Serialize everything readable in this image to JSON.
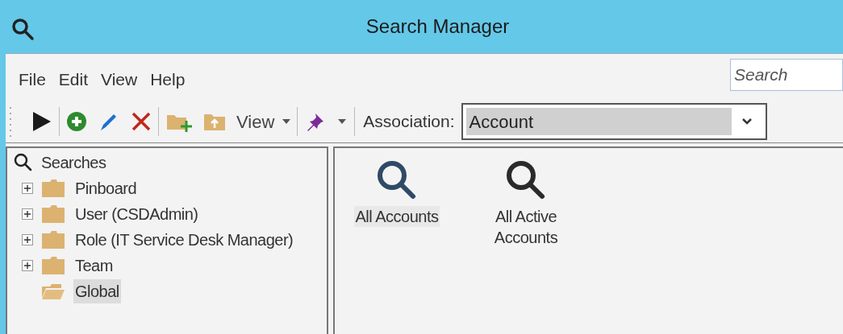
{
  "window": {
    "title": "Search Manager"
  },
  "menu": [
    "File",
    "Edit",
    "View",
    "Help"
  ],
  "search": {
    "placeholder": "Search"
  },
  "toolbar": {
    "view_label": "View",
    "association_label": "Association:",
    "association_value": "Account"
  },
  "tree": {
    "label": "Searches",
    "children": [
      {
        "label": "Pinboard",
        "expandable": true,
        "selected": false
      },
      {
        "label": "User (CSDAdmin)",
        "expandable": true,
        "selected": false
      },
      {
        "label": "Role (IT Service Desk Manager)",
        "expandable": true,
        "selected": false
      },
      {
        "label": "Team",
        "expandable": true,
        "selected": false
      },
      {
        "label": "Global",
        "expandable": false,
        "selected": true
      }
    ]
  },
  "searches": [
    {
      "label": "All Accounts",
      "selected": true
    },
    {
      "label": "All Active Accounts",
      "selected": false
    }
  ]
}
